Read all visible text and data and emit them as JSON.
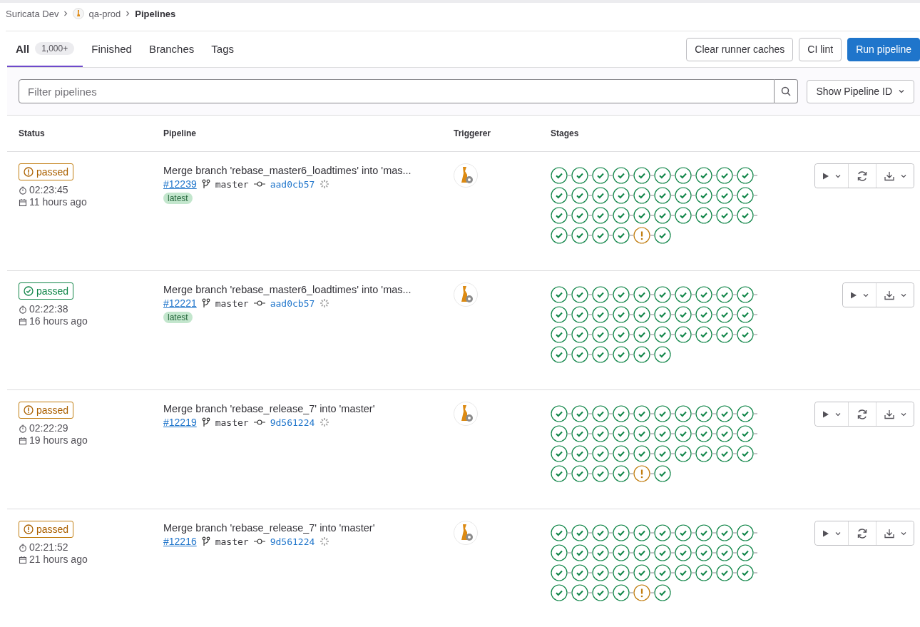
{
  "breadcrumbs": [
    {
      "label": "Suricata Dev",
      "kind": "group"
    },
    {
      "label": "qa-prod",
      "kind": "project"
    },
    {
      "label": "Pipelines",
      "kind": "current"
    }
  ],
  "tabs": [
    {
      "label": "All",
      "count": "1,000+",
      "selected": true
    },
    {
      "label": "Finished",
      "selected": false
    },
    {
      "label": "Branches",
      "selected": false
    },
    {
      "label": "Tags",
      "selected": false
    }
  ],
  "actions": [
    {
      "label": "Clear runner caches",
      "kind": "default"
    },
    {
      "label": "CI lint",
      "kind": "default"
    },
    {
      "label": "Run pipeline",
      "kind": "primary"
    }
  ],
  "filter": {
    "placeholder": "Filter pipelines"
  },
  "id_dropdown": {
    "label": "Show Pipeline ID"
  },
  "columns": [
    "Status",
    "Pipeline",
    "Triggerer",
    "Stages"
  ],
  "pipelines": [
    {
      "status": {
        "label": "passed",
        "kind": "warning"
      },
      "duration": "02:23:45",
      "finished": "11 hours ago",
      "title": "Merge branch 'rebase_master6_loadtimes' into 'mas...",
      "id": "#12239",
      "branch": "master",
      "commit": "aad0cb57",
      "tag": "latest",
      "retry": true,
      "stages": [
        {
          "kind": "success"
        },
        {
          "kind": "success"
        },
        {
          "kind": "success"
        },
        {
          "kind": "success"
        },
        {
          "kind": "success"
        },
        {
          "kind": "success"
        },
        {
          "kind": "success"
        },
        {
          "kind": "success"
        },
        {
          "kind": "success"
        },
        {
          "kind": "success"
        },
        {
          "kind": "success"
        },
        {
          "kind": "success"
        },
        {
          "kind": "success"
        },
        {
          "kind": "success"
        },
        {
          "kind": "success"
        },
        {
          "kind": "success"
        },
        {
          "kind": "success"
        },
        {
          "kind": "success"
        },
        {
          "kind": "success"
        },
        {
          "kind": "success"
        },
        {
          "kind": "success"
        },
        {
          "kind": "success"
        },
        {
          "kind": "success"
        },
        {
          "kind": "success"
        },
        {
          "kind": "success"
        },
        {
          "kind": "success"
        },
        {
          "kind": "success"
        },
        {
          "kind": "success"
        },
        {
          "kind": "success"
        },
        {
          "kind": "success"
        },
        {
          "kind": "success"
        },
        {
          "kind": "success"
        },
        {
          "kind": "success"
        },
        {
          "kind": "success"
        },
        {
          "kind": "warning"
        },
        {
          "kind": "success"
        }
      ]
    },
    {
      "status": {
        "label": "passed",
        "kind": "success"
      },
      "duration": "02:22:38",
      "finished": "16 hours ago",
      "title": "Merge branch 'rebase_master6_loadtimes' into 'mas...",
      "id": "#12221",
      "branch": "master",
      "commit": "aad0cb57",
      "tag": "latest",
      "retry": false,
      "stages": [
        {
          "kind": "success"
        },
        {
          "kind": "success"
        },
        {
          "kind": "success"
        },
        {
          "kind": "success"
        },
        {
          "kind": "success"
        },
        {
          "kind": "success"
        },
        {
          "kind": "success"
        },
        {
          "kind": "success"
        },
        {
          "kind": "success"
        },
        {
          "kind": "success"
        },
        {
          "kind": "success"
        },
        {
          "kind": "success"
        },
        {
          "kind": "success"
        },
        {
          "kind": "success"
        },
        {
          "kind": "success"
        },
        {
          "kind": "success"
        },
        {
          "kind": "success"
        },
        {
          "kind": "success"
        },
        {
          "kind": "success"
        },
        {
          "kind": "success"
        },
        {
          "kind": "success"
        },
        {
          "kind": "success"
        },
        {
          "kind": "success"
        },
        {
          "kind": "success"
        },
        {
          "kind": "success"
        },
        {
          "kind": "success"
        },
        {
          "kind": "success"
        },
        {
          "kind": "success"
        },
        {
          "kind": "success"
        },
        {
          "kind": "success"
        },
        {
          "kind": "success"
        },
        {
          "kind": "success"
        },
        {
          "kind": "success"
        },
        {
          "kind": "success"
        },
        {
          "kind": "success"
        },
        {
          "kind": "success"
        }
      ]
    },
    {
      "status": {
        "label": "passed",
        "kind": "warning"
      },
      "duration": "02:22:29",
      "finished": "19 hours ago",
      "title": "Merge branch 'rebase_release_7' into 'master'",
      "id": "#12219",
      "branch": "master",
      "commit": "9d561224",
      "retry": true,
      "stages": [
        {
          "kind": "success"
        },
        {
          "kind": "success"
        },
        {
          "kind": "success"
        },
        {
          "kind": "success"
        },
        {
          "kind": "success"
        },
        {
          "kind": "success"
        },
        {
          "kind": "success"
        },
        {
          "kind": "success"
        },
        {
          "kind": "success"
        },
        {
          "kind": "success"
        },
        {
          "kind": "success"
        },
        {
          "kind": "success"
        },
        {
          "kind": "success"
        },
        {
          "kind": "success"
        },
        {
          "kind": "success"
        },
        {
          "kind": "success"
        },
        {
          "kind": "success"
        },
        {
          "kind": "success"
        },
        {
          "kind": "success"
        },
        {
          "kind": "success"
        },
        {
          "kind": "success"
        },
        {
          "kind": "success"
        },
        {
          "kind": "success"
        },
        {
          "kind": "success"
        },
        {
          "kind": "success"
        },
        {
          "kind": "success"
        },
        {
          "kind": "success"
        },
        {
          "kind": "success"
        },
        {
          "kind": "success"
        },
        {
          "kind": "success"
        },
        {
          "kind": "success"
        },
        {
          "kind": "success"
        },
        {
          "kind": "success"
        },
        {
          "kind": "success"
        },
        {
          "kind": "warning"
        },
        {
          "kind": "success"
        }
      ]
    },
    {
      "status": {
        "label": "passed",
        "kind": "warning"
      },
      "duration": "02:21:52",
      "finished": "21 hours ago",
      "title": "Merge branch 'rebase_release_7' into 'master'",
      "id": "#12216",
      "branch": "master",
      "commit": "9d561224",
      "retry": true,
      "stages": [
        {
          "kind": "success"
        },
        {
          "kind": "success"
        },
        {
          "kind": "success"
        },
        {
          "kind": "success"
        },
        {
          "kind": "success"
        },
        {
          "kind": "success"
        },
        {
          "kind": "success"
        },
        {
          "kind": "success"
        },
        {
          "kind": "success"
        },
        {
          "kind": "success"
        },
        {
          "kind": "success"
        },
        {
          "kind": "success"
        },
        {
          "kind": "success"
        },
        {
          "kind": "success"
        },
        {
          "kind": "success"
        },
        {
          "kind": "success"
        },
        {
          "kind": "success"
        },
        {
          "kind": "success"
        },
        {
          "kind": "success"
        },
        {
          "kind": "success"
        },
        {
          "kind": "success"
        },
        {
          "kind": "success"
        },
        {
          "kind": "success"
        },
        {
          "kind": "success"
        },
        {
          "kind": "success"
        },
        {
          "kind": "success"
        },
        {
          "kind": "success"
        },
        {
          "kind": "success"
        },
        {
          "kind": "success"
        },
        {
          "kind": "success"
        },
        {
          "kind": "success"
        },
        {
          "kind": "success"
        },
        {
          "kind": "success"
        },
        {
          "kind": "success"
        },
        {
          "kind": "warning"
        },
        {
          "kind": "success"
        }
      ]
    }
  ]
}
